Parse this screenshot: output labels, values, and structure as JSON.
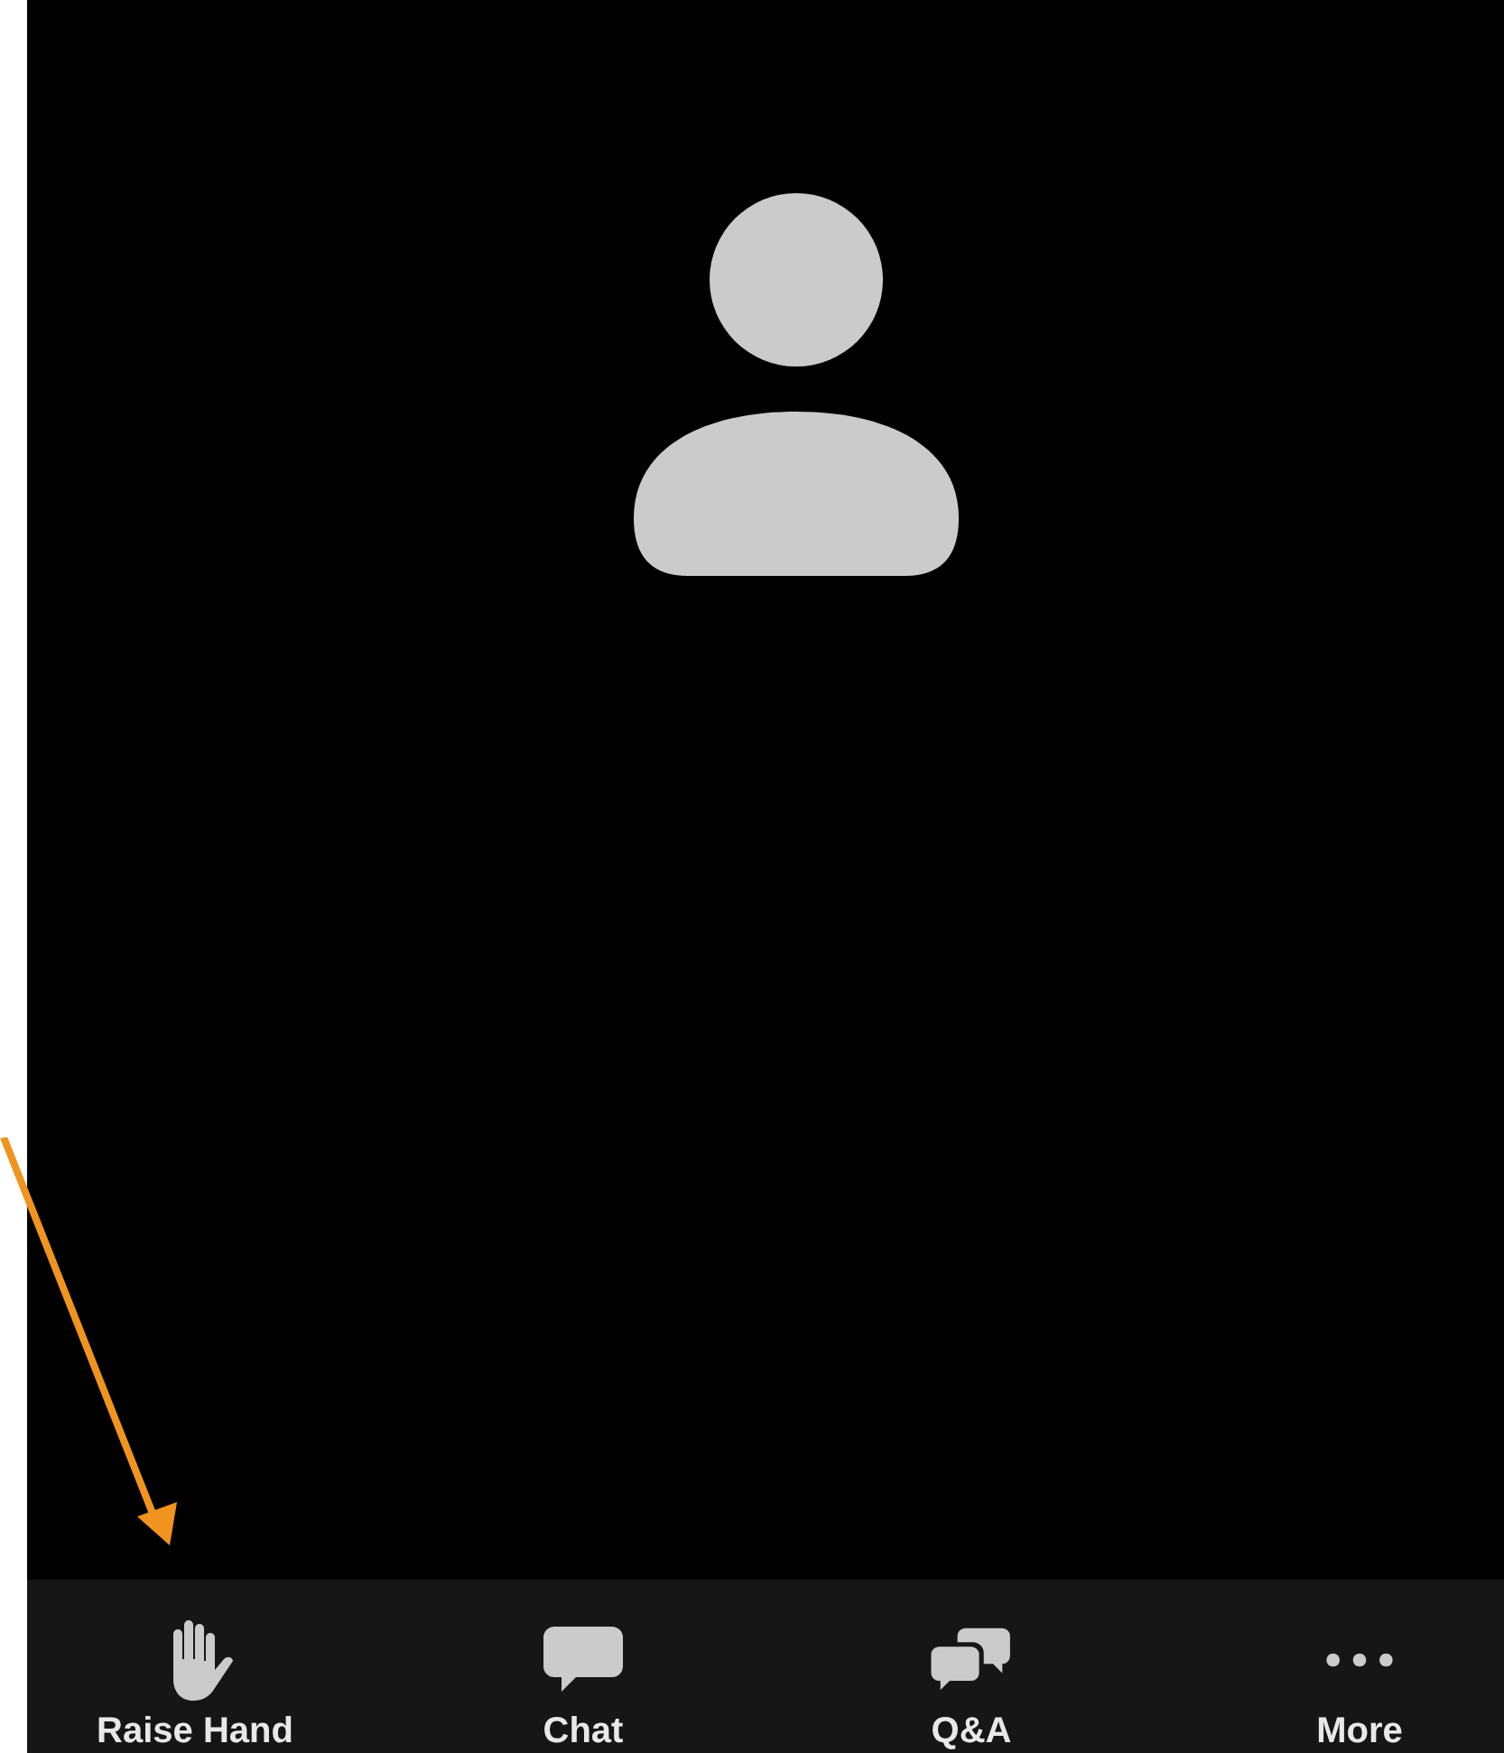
{
  "video": {
    "kind": "avatar"
  },
  "toolbar": [
    {
      "kind": "raise-hand",
      "label": "Raise Hand"
    },
    {
      "kind": "chat",
      "label": "Chat"
    },
    {
      "kind": "qa",
      "label": "Q&A"
    },
    {
      "kind": "more",
      "label": "More"
    }
  ]
}
